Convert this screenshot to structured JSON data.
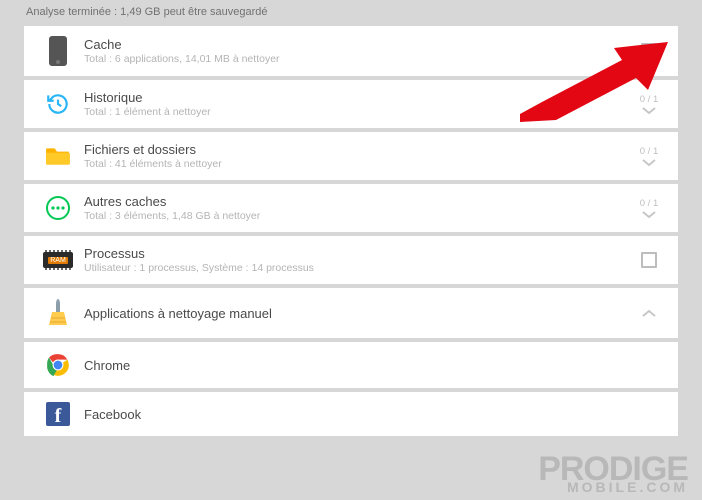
{
  "status": "Analyse terminée : 1,49 GB peut être sauvegardé",
  "items": {
    "cache": {
      "title": "Cache",
      "sub": "Total : 6 applications, 14,01 MB à nettoyer"
    },
    "history": {
      "title": "Historique",
      "sub": "Total : 1 élément à nettoyer",
      "counter": "0 / 1"
    },
    "files": {
      "title": "Fichiers et dossiers",
      "sub": "Total : 41 éléments à nettoyer",
      "counter": "0 / 1"
    },
    "other": {
      "title": "Autres caches",
      "sub": "Total : 3 éléments, 1,48 GB à nettoyer",
      "counter": "0 / 1"
    },
    "proc": {
      "title": "Processus",
      "sub": "Utilisateur : 1 processus, Système : 14 processus"
    },
    "manual": {
      "title": "Applications à nettoyage manuel"
    },
    "chrome": {
      "title": "Chrome"
    },
    "facebook": {
      "title": "Facebook"
    }
  },
  "watermark": {
    "line1": "PRODIGE",
    "line2": "MOBILE.COM"
  }
}
